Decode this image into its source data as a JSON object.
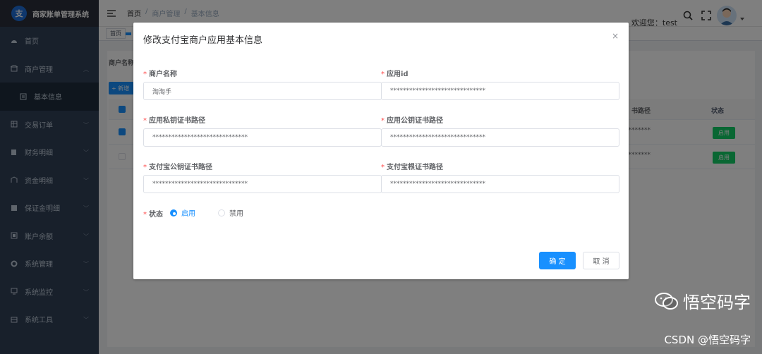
{
  "app": {
    "title": "商家账单管理系统",
    "logo_char": "支"
  },
  "sidebar": {
    "items": [
      {
        "label": "首页",
        "icon": "dashboard-icon"
      },
      {
        "label": "商户管理",
        "icon": "merchant-icon",
        "chevron": "︿"
      },
      {
        "label": "基本信息",
        "icon": "list-icon"
      },
      {
        "label": "交易订单",
        "icon": "table-icon",
        "chevron": "﹀"
      },
      {
        "label": "财务明细",
        "icon": "finance-icon",
        "chevron": "﹀"
      },
      {
        "label": "资金明细",
        "icon": "fund-icon",
        "chevron": "﹀"
      },
      {
        "label": "保证金明细",
        "icon": "deposit-icon",
        "chevron": "﹀"
      },
      {
        "label": "账户余额",
        "icon": "balance-icon",
        "chevron": "﹀"
      },
      {
        "label": "系统管理",
        "icon": "gear-icon",
        "chevron": "﹀"
      },
      {
        "label": "系统监控",
        "icon": "monitor-icon",
        "chevron": "﹀"
      },
      {
        "label": "系统工具",
        "icon": "tool-icon",
        "chevron": "﹀"
      }
    ]
  },
  "header": {
    "breadcrumb": [
      "首页",
      "/",
      "商户管理",
      "/",
      "基本信息"
    ],
    "welcome": "欢迎您：test"
  },
  "tags": [
    "首页"
  ],
  "main": {
    "filter_label": "商户名称",
    "add_button": "+ 新增",
    "table": {
      "col_path": "书路径",
      "col_status": "状态",
      "rows": [
        {
          "masked": "**********",
          "status": "启用"
        },
        {
          "masked": "**********",
          "status": "启用"
        }
      ]
    }
  },
  "dialog": {
    "title": "修改支付宝商户应用基本信息",
    "close": "×",
    "fields": {
      "merchant_name": {
        "label": "商户名称",
        "value": "淘淘手"
      },
      "app_id": {
        "label": "应用id",
        "value": "******************************"
      },
      "app_private_cert": {
        "label": "应用私钥证书路径",
        "value": "******************************"
      },
      "app_public_cert": {
        "label": "应用公钥证书路径",
        "value": "******************************"
      },
      "alipay_public_cert": {
        "label": "支付宝公钥证书路径",
        "value": "******************************"
      },
      "alipay_root_cert": {
        "label": "支付宝根证书路径",
        "value": "******************************"
      }
    },
    "required_mark": "*",
    "status_label": "状态",
    "status_options": [
      "启用",
      "禁用"
    ],
    "status_selected": "启用",
    "confirm": "确 定",
    "cancel": "取 消"
  },
  "watermark": {
    "name": "悟空码字",
    "csdn": "CSDN @悟空码字"
  },
  "colors": {
    "primary": "#1890ff",
    "sidebar_bg": "#304156",
    "success": "#13ce66",
    "danger": "#ff4949"
  }
}
